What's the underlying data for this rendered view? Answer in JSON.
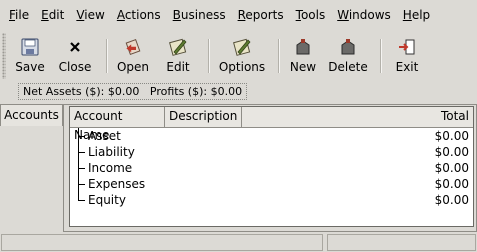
{
  "menubar": [
    {
      "pre": "",
      "ul": "F",
      "post": "ile"
    },
    {
      "pre": "",
      "ul": "E",
      "post": "dit"
    },
    {
      "pre": "",
      "ul": "V",
      "post": "iew"
    },
    {
      "pre": "",
      "ul": "A",
      "post": "ctions"
    },
    {
      "pre": "",
      "ul": "B",
      "post": "usiness"
    },
    {
      "pre": "",
      "ul": "R",
      "post": "eports"
    },
    {
      "pre": "",
      "ul": "T",
      "post": "ools"
    },
    {
      "pre": "",
      "ul": "W",
      "post": "indows"
    },
    {
      "pre": "",
      "ul": "H",
      "post": "elp"
    }
  ],
  "toolbar": {
    "save": "Save",
    "close": "Close",
    "open": "Open",
    "edit": "Edit",
    "options": "Options",
    "new": "New",
    "delete": "Delete",
    "exit": "Exit"
  },
  "summary": {
    "net_assets": "Net Assets ($): $0.00",
    "profits": "Profits ($): $0.00"
  },
  "tab": {
    "label": "Accounts"
  },
  "columns": {
    "name": "Account Name",
    "description": "Description",
    "total": "Total"
  },
  "accounts": [
    {
      "name": "Asset",
      "total": "$0.00"
    },
    {
      "name": "Liability",
      "total": "$0.00"
    },
    {
      "name": "Income",
      "total": "$0.00"
    },
    {
      "name": "Expenses",
      "total": "$0.00"
    },
    {
      "name": "Equity",
      "total": "$0.00"
    }
  ],
  "colors": {
    "background": "#dcdad5",
    "tree_background": "#ffffff"
  }
}
